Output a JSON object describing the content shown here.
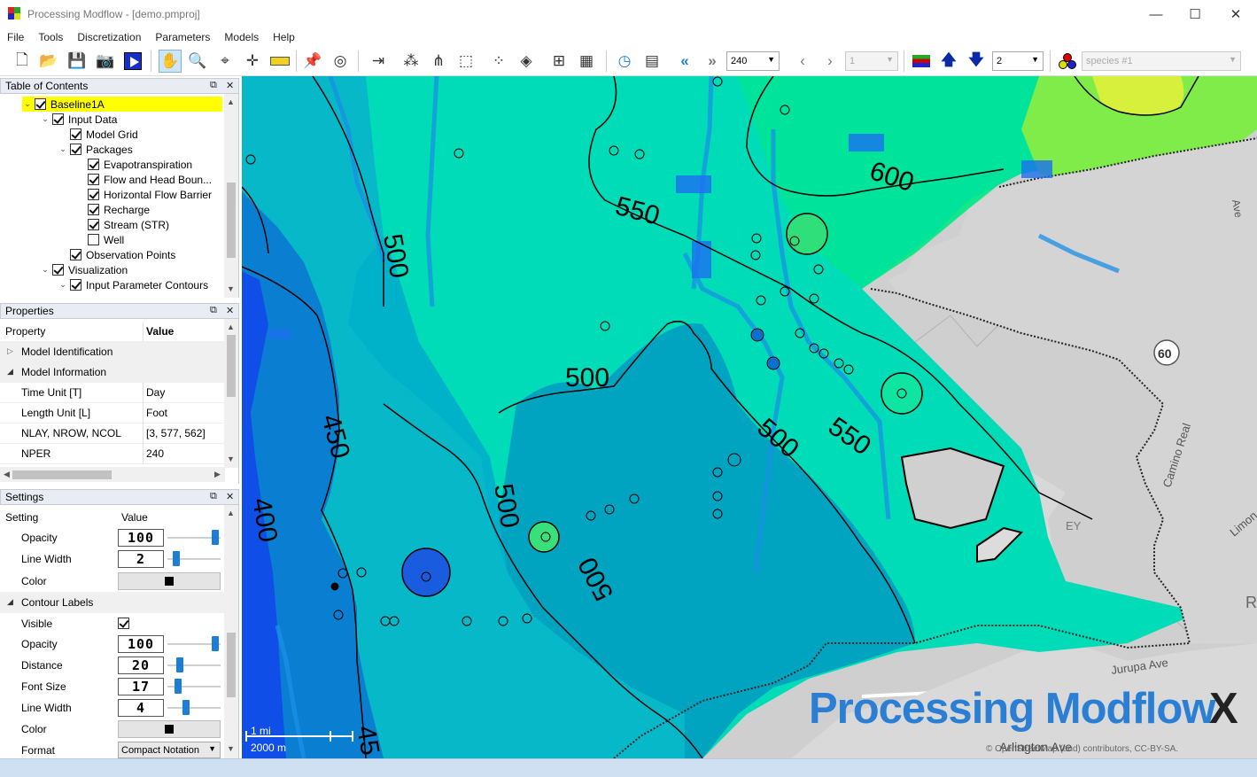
{
  "window": {
    "title": "Processing Modflow - [demo.pmproj]",
    "minimize": "—",
    "maximize": "☐",
    "close": "✕"
  },
  "menu": [
    "File",
    "Tools",
    "Discretization",
    "Parameters",
    "Models",
    "Help"
  ],
  "toolbar": {
    "stress_period": "240",
    "layer_index": "1",
    "layer_count": "2",
    "species": "species #1"
  },
  "toc": {
    "title": "Table of Contents",
    "items": [
      {
        "label": "Baseline1A",
        "checked": true
      },
      {
        "label": "Input Data",
        "checked": true
      },
      {
        "label": "Model Grid",
        "checked": true
      },
      {
        "label": "Packages",
        "checked": true
      },
      {
        "label": "Evapotranspiration",
        "checked": true
      },
      {
        "label": "Flow and Head Boun...",
        "checked": true
      },
      {
        "label": "Horizontal Flow Barrier",
        "checked": true
      },
      {
        "label": "Recharge",
        "checked": true
      },
      {
        "label": "Stream (STR)",
        "checked": true
      },
      {
        "label": "Well",
        "checked": false
      },
      {
        "label": "Observation Points",
        "checked": true
      },
      {
        "label": "Visualization",
        "checked": true
      },
      {
        "label": "Input Parameter Contours",
        "checked": true
      }
    ]
  },
  "properties": {
    "title": "Properties",
    "col_property": "Property",
    "col_value": "Value",
    "groups": {
      "identification": "Model Identification",
      "information": "Model Information"
    },
    "rows": [
      {
        "k": "Time Unit [T]",
        "v": "Day"
      },
      {
        "k": "Length Unit [L]",
        "v": "Foot"
      },
      {
        "k": "NLAY, NROW, NCOL",
        "v": "[3, 577, 562]"
      },
      {
        "k": "NPER",
        "v": "240"
      }
    ]
  },
  "settings": {
    "title": "Settings",
    "col_setting": "Setting",
    "col_value": "Value",
    "opacity_label": "Opacity",
    "opacity": "100",
    "line_width_label": "Line Width",
    "line_width": "2",
    "color_label": "Color",
    "contour_labels_group": "Contour Labels",
    "visible_label": "Visible",
    "label_opacity_label": "Opacity",
    "label_opacity": "100",
    "distance_label": "Distance",
    "distance": "20",
    "font_size_label": "Font Size",
    "font_size": "17",
    "label_line_width_label": "Line Width",
    "label_line_width": "4",
    "label_color_label": "Color",
    "format_label": "Format",
    "format": "Compact Notation"
  },
  "map": {
    "contour_labels": [
      "500",
      "550",
      "600",
      "500",
      "550",
      "500",
      "450",
      "500",
      "400",
      "500",
      "45"
    ],
    "road_labels": [
      "60",
      "Camino Real",
      "Jurupa Ave",
      "Arlington Ave",
      "Limon",
      "Ave",
      "EY",
      "R"
    ],
    "scale": {
      "top": "1 mi",
      "bottom": "2000 m"
    },
    "watermark_a": "Processing Modflow",
    "watermark_b": "X",
    "attribution": "© OpenStreetMap (and) contributors, CC-BY-SA."
  },
  "colors": {
    "title_bg": "#ffffff",
    "panel_head": "#e9edf3",
    "selected": "#ffff00",
    "accent_blue": "#1c7ed6",
    "status": "#cfe0f3"
  }
}
